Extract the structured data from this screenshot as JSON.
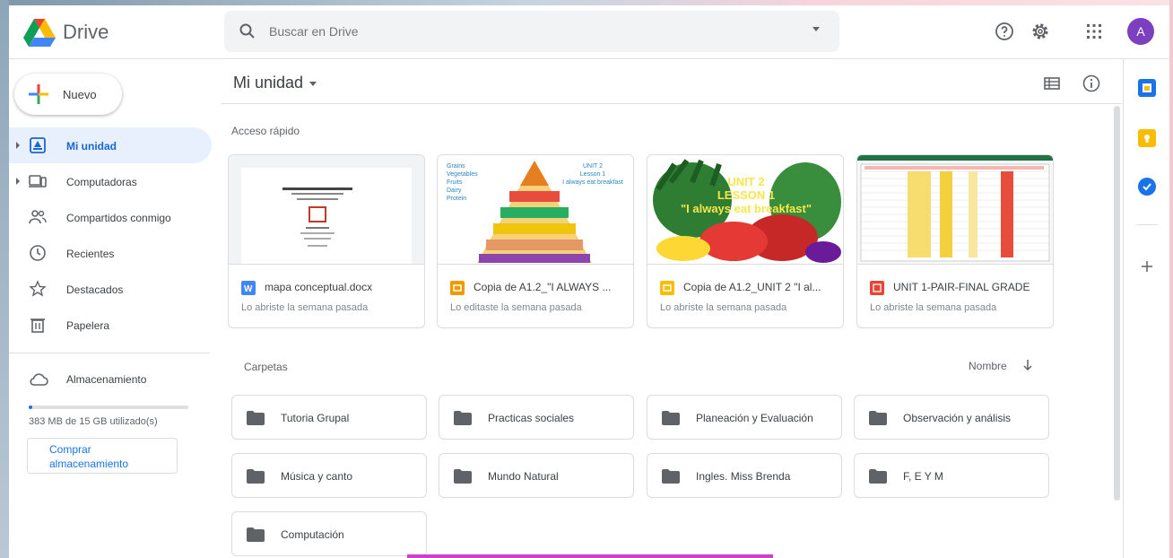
{
  "header": {
    "brand": "Drive",
    "search_placeholder": "Buscar en Drive",
    "avatar_initial": "A",
    "icons": [
      "help-icon",
      "settings-icon",
      "apps-icon"
    ]
  },
  "sidebar": {
    "new_label": "Nuevo",
    "items": [
      {
        "label": "Mi unidad",
        "icon": "my-drive-icon"
      },
      {
        "label": "Computadoras",
        "icon": "computers-icon"
      },
      {
        "label": "Compartidos conmigo",
        "icon": "shared-icon"
      },
      {
        "label": "Recientes",
        "icon": "clock-icon"
      },
      {
        "label": "Destacados",
        "icon": "star-icon"
      },
      {
        "label": "Papelera",
        "icon": "trash-icon"
      }
    ],
    "storage_label": "Almacenamiento",
    "storage_used_text": "383 MB de 15 GB utilizado(s)",
    "storage_fraction": 0.025,
    "buy_label_1": "Comprar",
    "buy_label_2": "almacenamiento"
  },
  "main": {
    "title": "Mi unidad",
    "quick_access_label": "Acceso rápido",
    "folders_label": "Carpetas",
    "sort_label": "Nombre",
    "quick_access": [
      {
        "name": "mapa conceptual.docx",
        "meta": "Lo abriste la semana pasada",
        "type": "word",
        "color": "#4285f4"
      },
      {
        "name": "Copia de A1.2_\"I ALWAYS ...",
        "meta": "Lo editaste la semana pasada",
        "type": "slides",
        "color": "#f29900",
        "thumb_text": [
          "UNIT 2",
          "Lesson 1",
          "I always eat breakfast"
        ],
        "thumb_list": [
          "Grains",
          "Vegetables",
          "Fruits",
          "Dairy",
          "Protein"
        ]
      },
      {
        "name": "Copia de A1.2_UNIT 2 \"I al...",
        "meta": "Lo abriste la semana pasada",
        "type": "slides",
        "color": "#fbbc04",
        "thumb_text": [
          "UNIT 2",
          "LESSON 1",
          "\"I always eat breakfast\""
        ]
      },
      {
        "name": "UNIT 1-PAIR-FINAL GRADE",
        "meta": "Lo abriste la semana pasada",
        "type": "pdf",
        "color": "#ea4335"
      }
    ],
    "folders": [
      "Tutoria Grupal",
      "Practicas sociales",
      "Planeación y Evaluación",
      "Observación y análisis",
      "Música y canto",
      "Mundo Natural",
      "Ingles. Miss Brenda",
      "F, E Y M",
      "Computación"
    ]
  },
  "colors": {
    "accent": "#1a73e8",
    "active_bg": "#e8f0fe",
    "avatar": "#7b3fbf"
  }
}
